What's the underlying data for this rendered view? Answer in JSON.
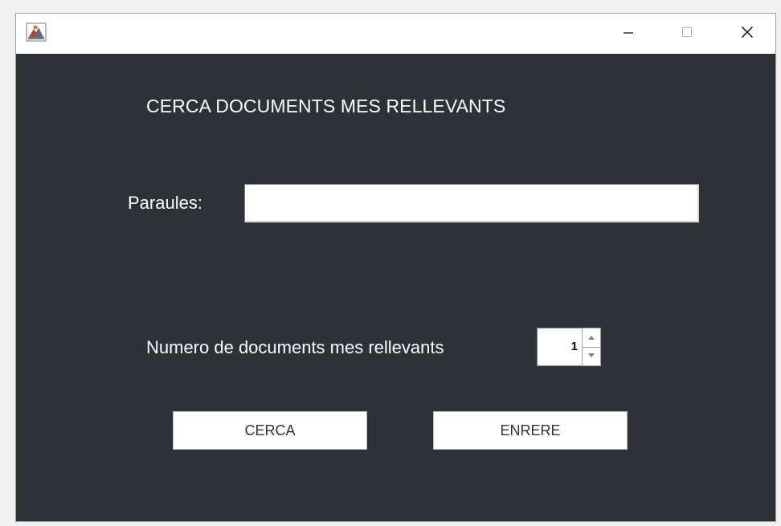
{
  "window": {
    "title": "",
    "app_icon": "java-app-icon",
    "controls": {
      "minimize_icon": "minimize-icon",
      "maximize_icon": "maximize-icon",
      "close_icon": "close-icon"
    }
  },
  "form": {
    "heading": "CERCA DOCUMENTS MES RELLEVANTS",
    "paraules_label": "Paraules:",
    "paraules_value": "",
    "num_label": "Numero de documents mes rellevants",
    "num_value": "1",
    "cerca_label": "CERCA",
    "enrere_label": "ENRERE"
  },
  "colors": {
    "background": "#2d3239",
    "text": "#ffffff",
    "titlebar": "#ffffff"
  }
}
